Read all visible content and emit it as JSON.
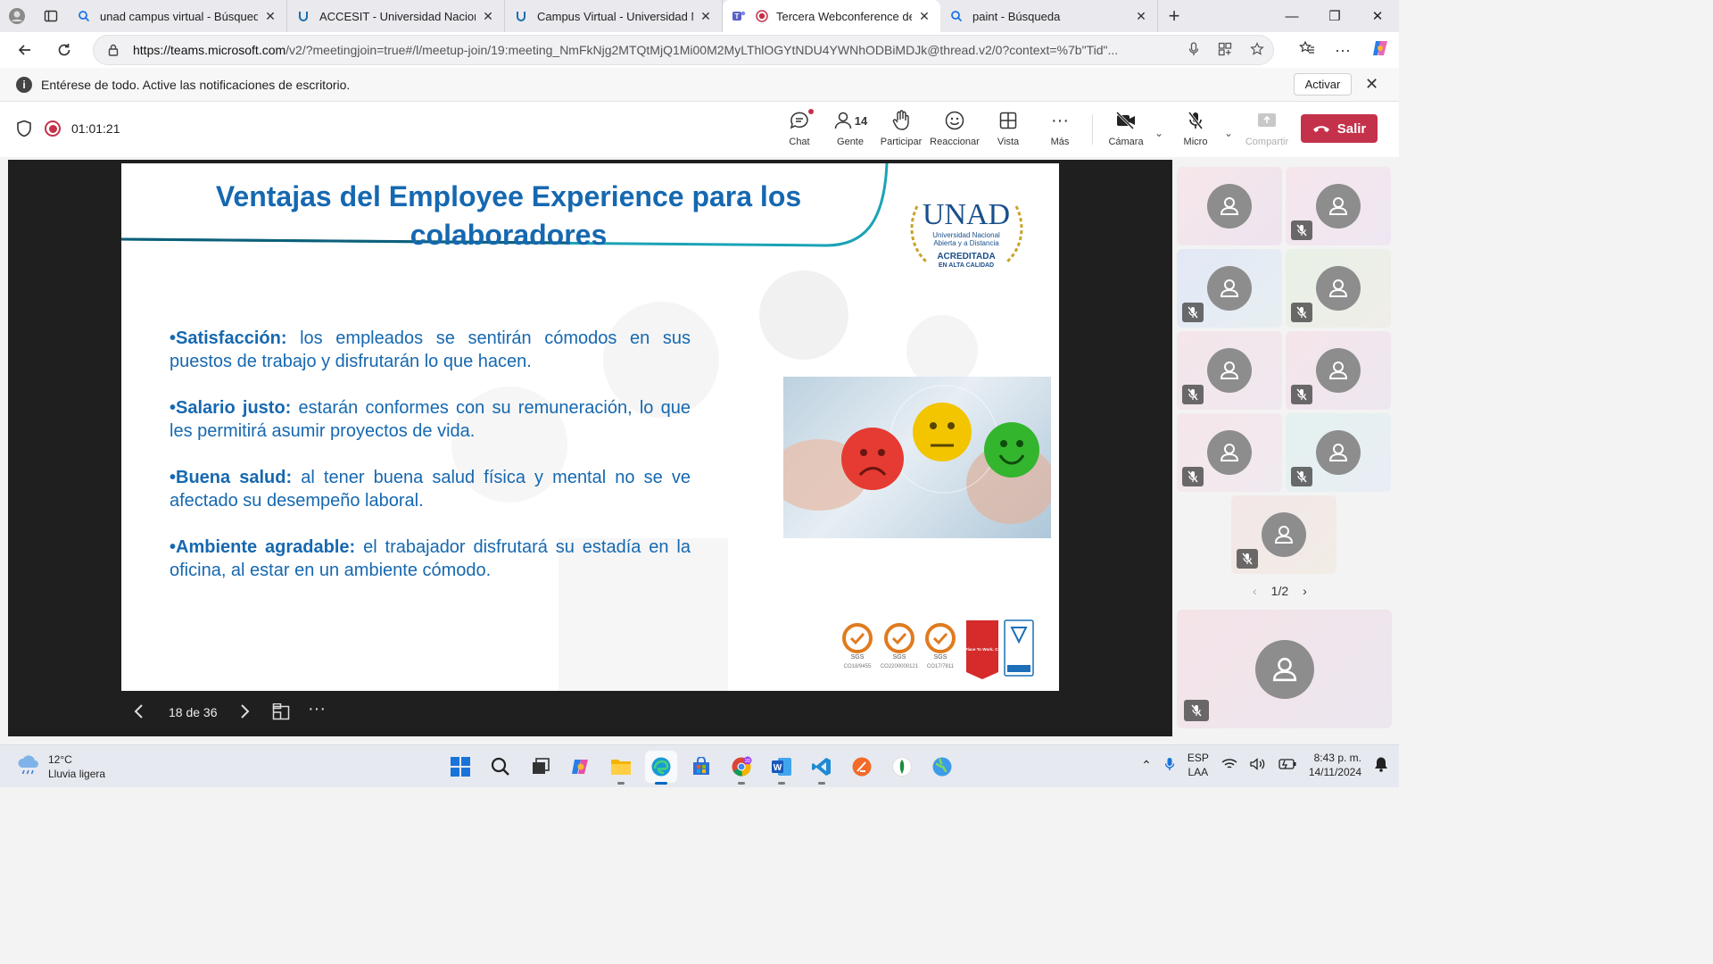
{
  "browser": {
    "tabs": [
      {
        "title": "unad campus virtual - Búsqueda",
        "icon": "search-icon"
      },
      {
        "title": "ACCESIT - Universidad Nacional Abierta",
        "icon": "unad-icon"
      },
      {
        "title": "Campus Virtual - Universidad Nacional",
        "icon": "unad-icon"
      },
      {
        "title": "Tercera Webconference de B",
        "icon": "teams-icon"
      },
      {
        "title": "paint - Búsqueda",
        "icon": "search-icon"
      }
    ],
    "url_host": "https://teams.microsoft.com",
    "url_path": "/v2/?meetingjoin=true#/l/meetup-join/19:meeting_NmFkNjg2MTQtMjQ1Mi00M2MyLThlOGYtNDU4YWNhODBiMDJk@thread.v2/0?context=%7b\"Tid\"..."
  },
  "notification": {
    "message": "Entérese de todo. Active las notificaciones de escritorio.",
    "action": "Activar"
  },
  "meeting": {
    "timer": "01:01:21",
    "buttons": {
      "chat": "Chat",
      "people": "Gente",
      "people_count": "14",
      "raise": "Participar",
      "react": "Reaccionar",
      "view": "Vista",
      "more": "Más",
      "camera": "Cámara",
      "mic": "Micro",
      "share": "Compartir",
      "leave": "Salir"
    }
  },
  "slide": {
    "title": "Ventajas del Employee Experience para los colaboradores",
    "logo": {
      "name": "UNAD",
      "line1": "Universidad Nacional",
      "line2": "Abierta y a Distancia",
      "line3": "ACREDITADA",
      "line4": "EN ALTA CALIDAD"
    },
    "bullets": [
      {
        "term": "•Satisfacción:",
        "text": " los empleados se sentirán cómodos en sus puestos de trabajo y disfrutarán lo que hacen."
      },
      {
        "term": "•Salario justo:",
        "text": " estarán conformes con su remuneración, lo que les permitirá asumir proyectos de vida."
      },
      {
        "term": "•Buena salud:",
        "text": " al tener buena salud física y mental no se ve afectado su desempeño laboral."
      },
      {
        "term": "•Ambiente agradable:",
        "text": " el trabajador disfrutará su estadía en la oficina, al estar en un ambiente cómodo."
      }
    ],
    "certs": [
      "CO18/9455",
      "CO2200000121",
      "CO17/7811",
      "Great Place To Work. Certified"
    ],
    "counter": "18 de 36"
  },
  "participants": {
    "pager": "1/2"
  },
  "taskbar": {
    "weather_temp": "12°C",
    "weather_desc": "Lluvia ligera",
    "lang1": "ESP",
    "lang2": "LAA",
    "time": "8:43 p. m.",
    "date": "14/11/2024"
  }
}
